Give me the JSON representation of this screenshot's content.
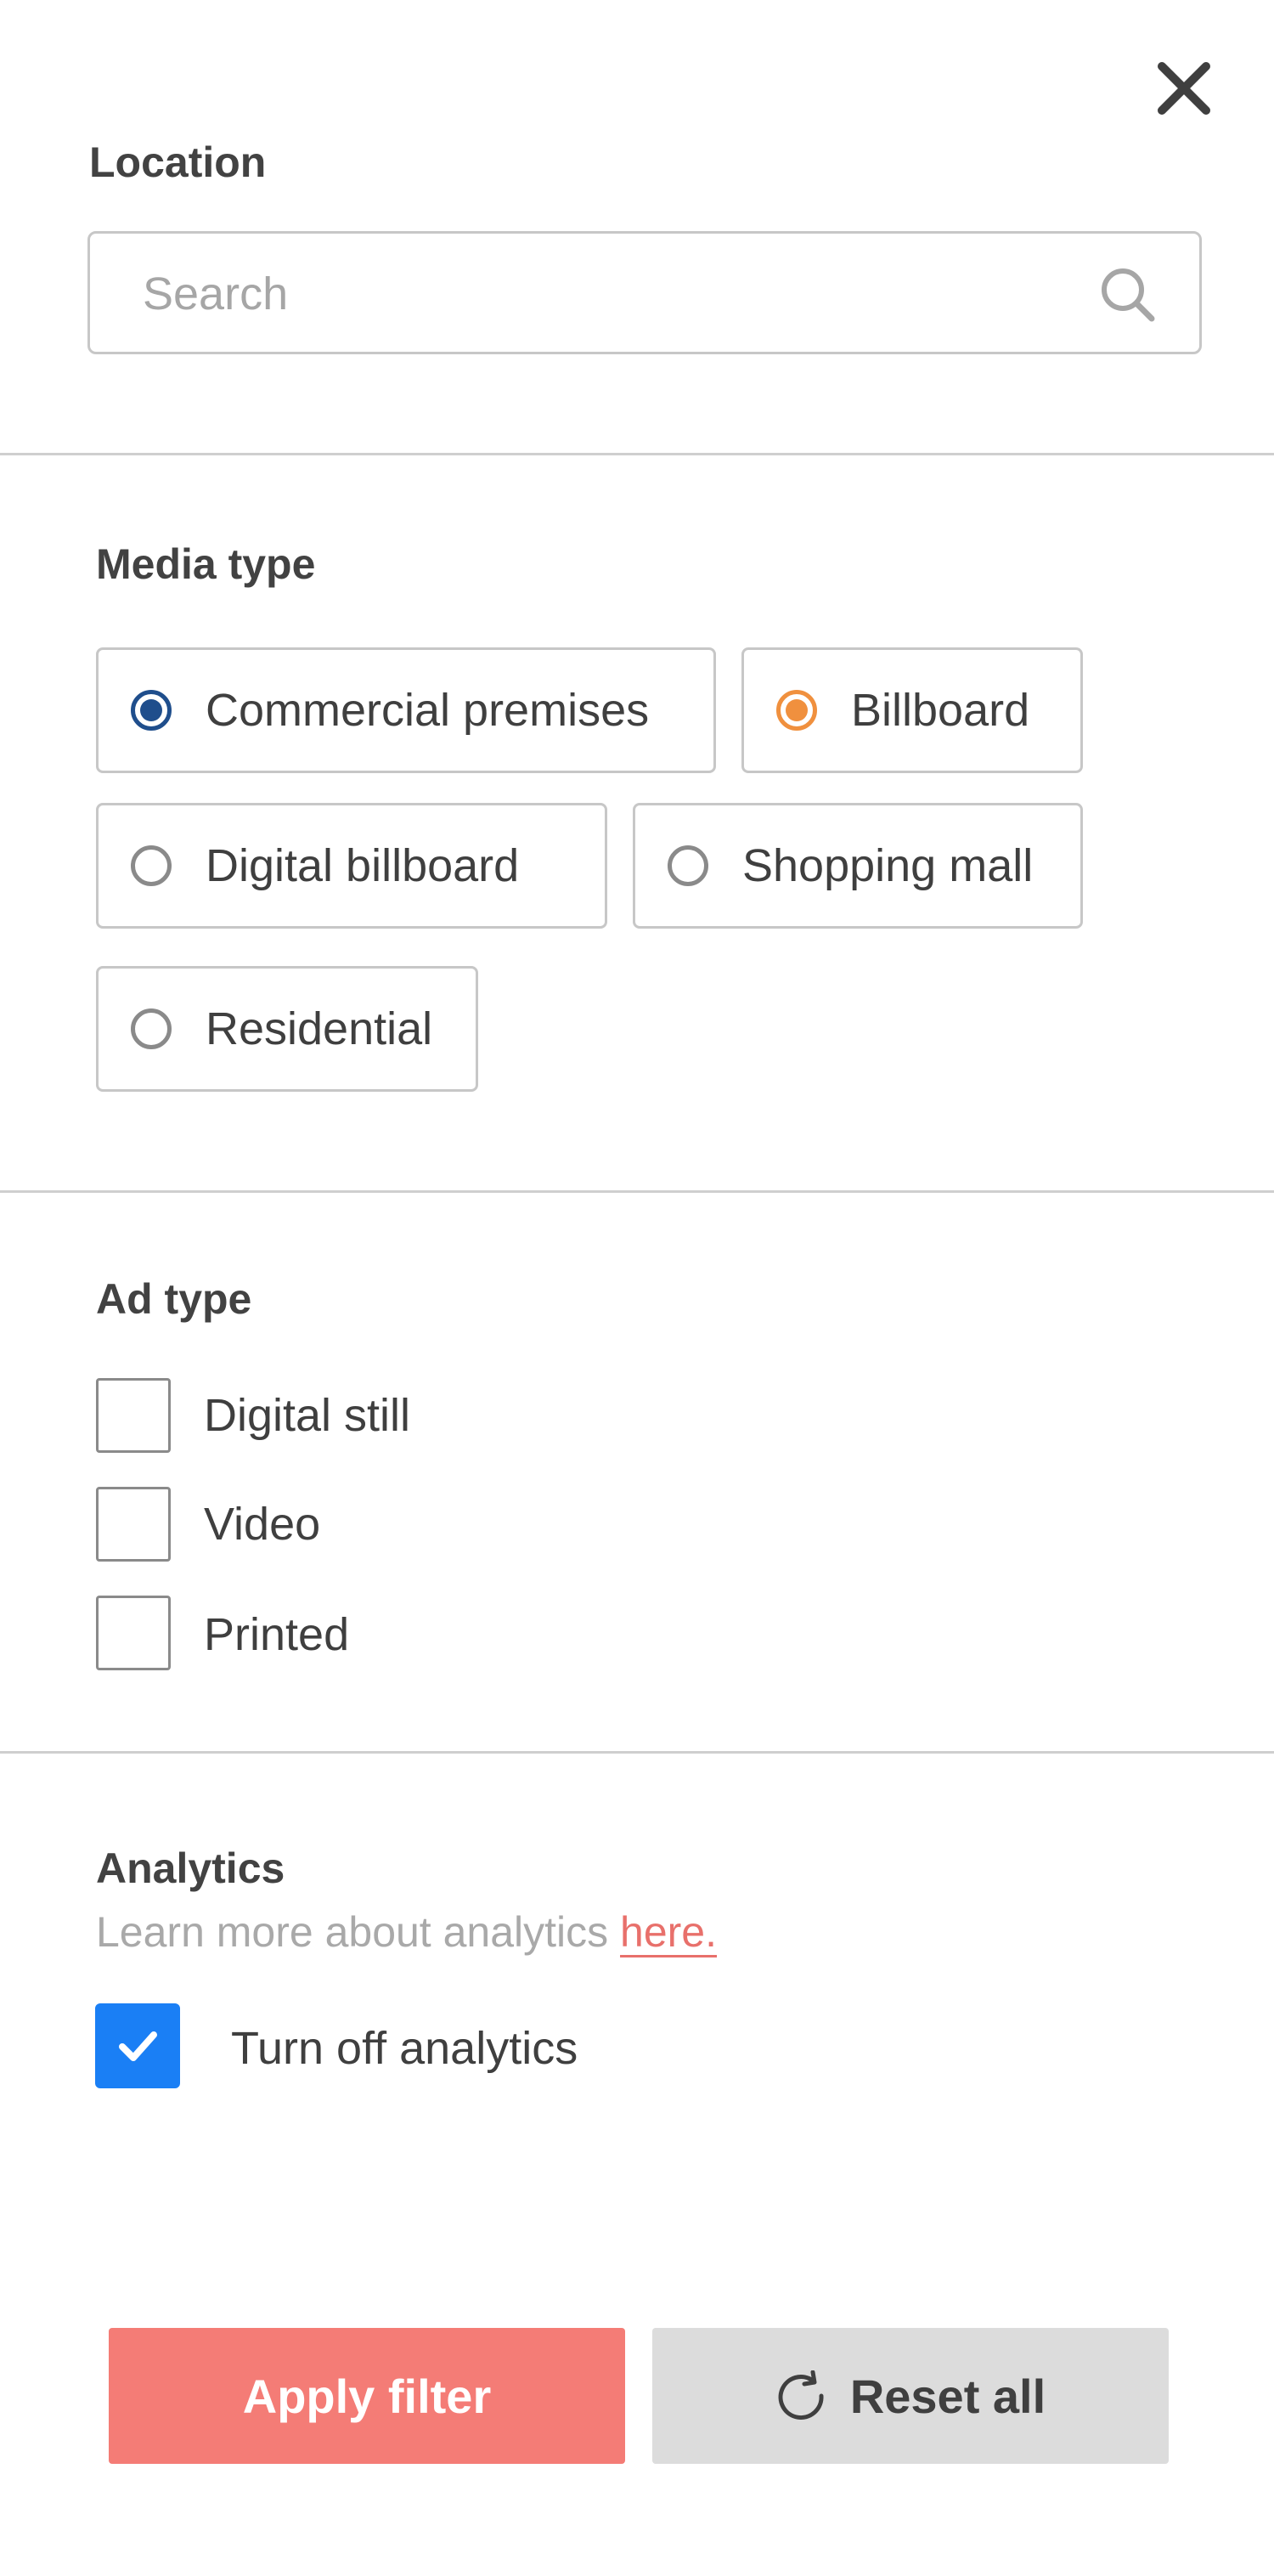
{
  "close": {
    "icon": "close-icon"
  },
  "location": {
    "title": "Location",
    "search": {
      "placeholder": "Search",
      "value": ""
    }
  },
  "media_type": {
    "title": "Media type",
    "options": [
      {
        "label": "Commercial premises",
        "selected": true,
        "color": "#1f4e8c"
      },
      {
        "label": "Billboard",
        "selected": true,
        "color": "#f0903e"
      },
      {
        "label": "Digital billboard",
        "selected": false
      },
      {
        "label": "Shopping mall",
        "selected": false
      },
      {
        "label": "Residential",
        "selected": false
      }
    ]
  },
  "ad_type": {
    "title": "Ad type",
    "options": [
      {
        "label": "Digital still",
        "checked": false
      },
      {
        "label": "Video",
        "checked": false
      },
      {
        "label": "Printed",
        "checked": false
      }
    ]
  },
  "analytics": {
    "title": "Analytics",
    "subtext": "Learn more about analytics ",
    "link_text": "here.",
    "toggle": {
      "label": "Turn off analytics",
      "checked": true,
      "color": "#1a7ff5"
    }
  },
  "actions": {
    "apply_label": "Apply filter",
    "reset_label": "Reset all",
    "apply_color": "#f47c76",
    "reset_color": "#dcdcdc"
  }
}
